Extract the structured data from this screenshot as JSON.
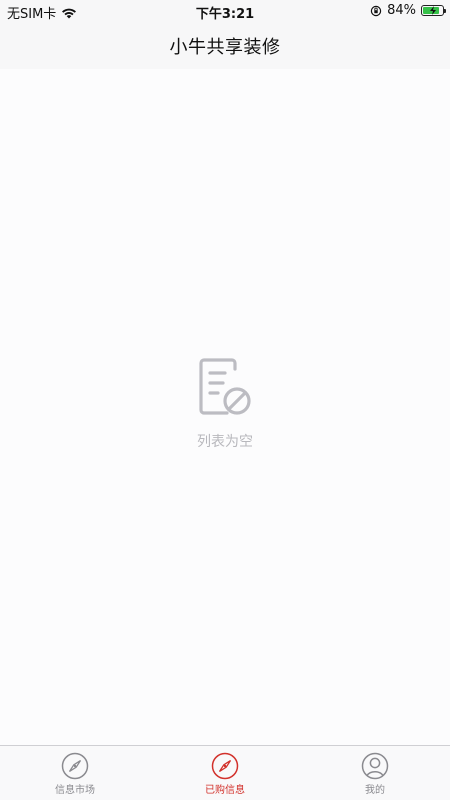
{
  "status_bar": {
    "carrier": "无SIM卡",
    "time": "下午3:21",
    "battery": "84%",
    "battery_level": 0.84
  },
  "nav": {
    "title": "小牛共享装修"
  },
  "empty_state": {
    "icon": "empty-list-icon",
    "text": "列表为空"
  },
  "tabs": [
    {
      "label": "信息市场",
      "icon": "compass-icon",
      "active": false
    },
    {
      "label": "已购信息",
      "icon": "compass-icon",
      "active": true
    },
    {
      "label": "我的",
      "icon": "user-icon",
      "active": false
    }
  ],
  "colors": {
    "accent": "#d2312b",
    "tab_inactive": "#8a8a8f",
    "battery_green": "#36c149",
    "empty_gray": "#b8b8bd"
  }
}
